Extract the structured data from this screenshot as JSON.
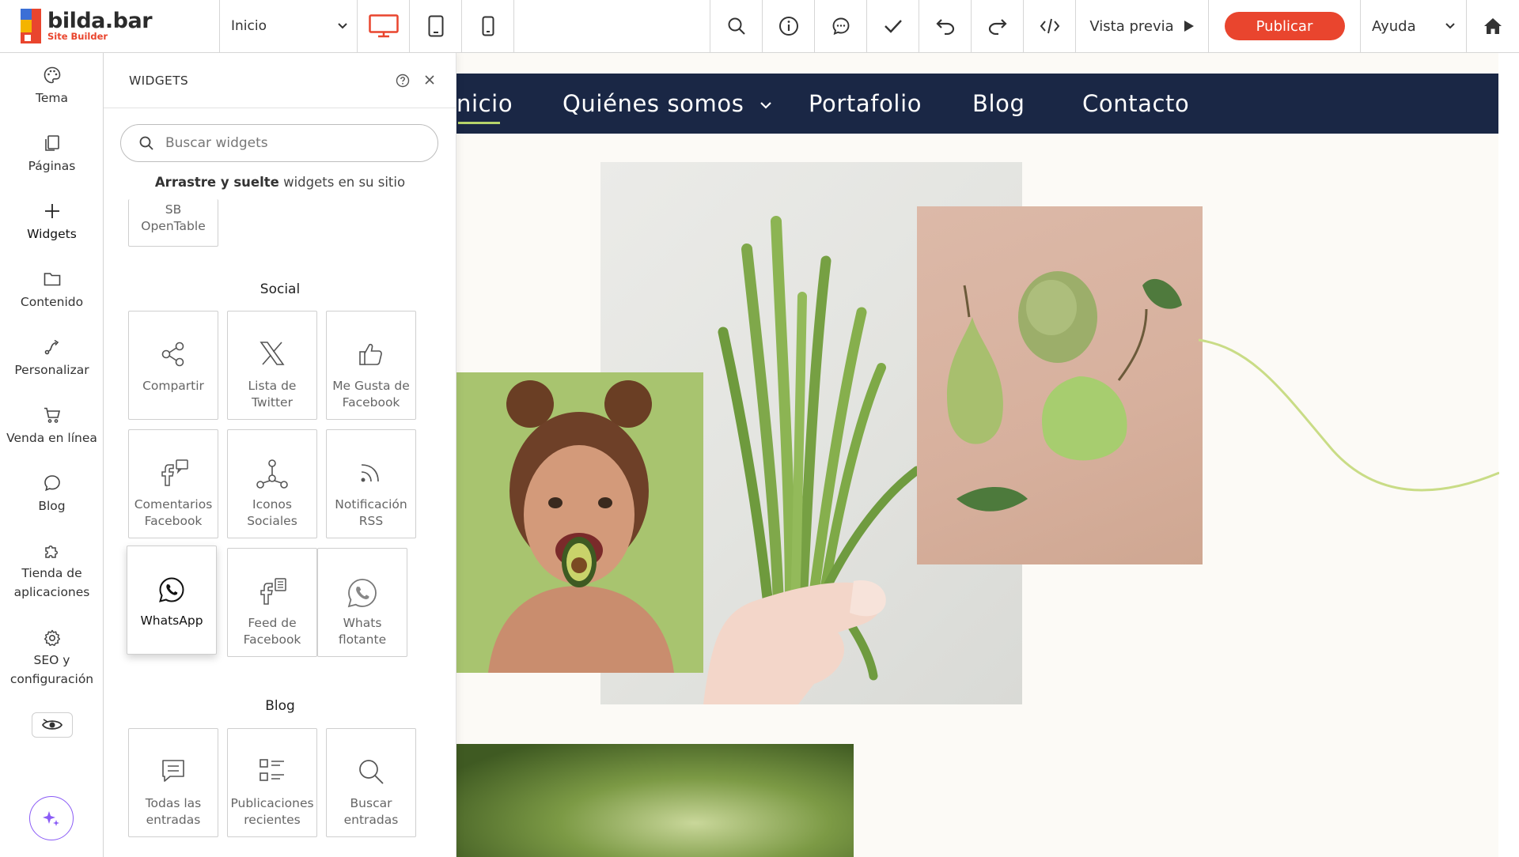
{
  "toolbar": {
    "logo_name": "bilda.bar",
    "logo_sub": "Site Builder",
    "page_select": "Inicio",
    "preview": "Vista previa",
    "publish": "Publicar",
    "help": "Ayuda",
    "accent": "#e9452e"
  },
  "rail": {
    "items": [
      {
        "label": "Tema",
        "icon": "palette-icon"
      },
      {
        "label": "Páginas",
        "icon": "pages-icon"
      },
      {
        "label": "Widgets",
        "icon": "plus-icon"
      },
      {
        "label": "Contenido",
        "icon": "folder-icon"
      },
      {
        "label": "Personalizar",
        "icon": "customize-icon"
      },
      {
        "label": "Venda en línea",
        "icon": "cart-icon"
      },
      {
        "label": "Blog",
        "icon": "chat-icon"
      },
      {
        "label": "Tienda de",
        "label2": "aplicaciones",
        "icon": "puzzle-icon"
      },
      {
        "label": "SEO y",
        "label2": "configuración",
        "icon": "gear-icon"
      }
    ]
  },
  "panel": {
    "title": "WIDGETS",
    "search_placeholder": "Buscar widgets",
    "hint_bold": "Arrastre y suelte",
    "hint_rest": " widgets en su sitio",
    "partial_card": {
      "line1": "SB",
      "line2": "OpenTable"
    },
    "social_title": "Social",
    "social": [
      {
        "line1": "Compartir",
        "line2": "",
        "icon": "share-icon"
      },
      {
        "line1": "Lista de",
        "line2": "Twitter",
        "icon": "x-twitter-icon"
      },
      {
        "line1": "Me Gusta de",
        "line2": "Facebook",
        "icon": "thumbs-up-icon"
      },
      {
        "line1": "Comentarios",
        "line2": "Facebook",
        "icon": "facebook-comments-icon"
      },
      {
        "line1": "Iconos",
        "line2": "Sociales",
        "icon": "social-icons-icon"
      },
      {
        "line1": "Notificación",
        "line2": "RSS",
        "icon": "rss-icon"
      },
      {
        "line1": "WhatsApp",
        "line2": "",
        "icon": "whatsapp-icon"
      },
      {
        "line1": "Feed de",
        "line2": "Facebook",
        "icon": "facebook-feed-icon"
      },
      {
        "line1": "Whats",
        "line2": "flotante",
        "icon": "whatsapp-float-icon"
      }
    ],
    "blog_title": "Blog",
    "blog": [
      {
        "line1": "Todas las",
        "line2": "entradas",
        "icon": "all-posts-icon"
      },
      {
        "line1": "Publicaciones",
        "line2": "recientes",
        "icon": "recent-posts-icon"
      },
      {
        "line1": "Buscar",
        "line2": "entradas",
        "icon": "search-posts-icon"
      }
    ]
  },
  "site": {
    "nav": [
      "nicio",
      "Quiénes somos",
      "Portafolio",
      "Blog",
      "Contacto"
    ],
    "nav_color": "#1a2745",
    "accent_green": "#b6d46a"
  }
}
